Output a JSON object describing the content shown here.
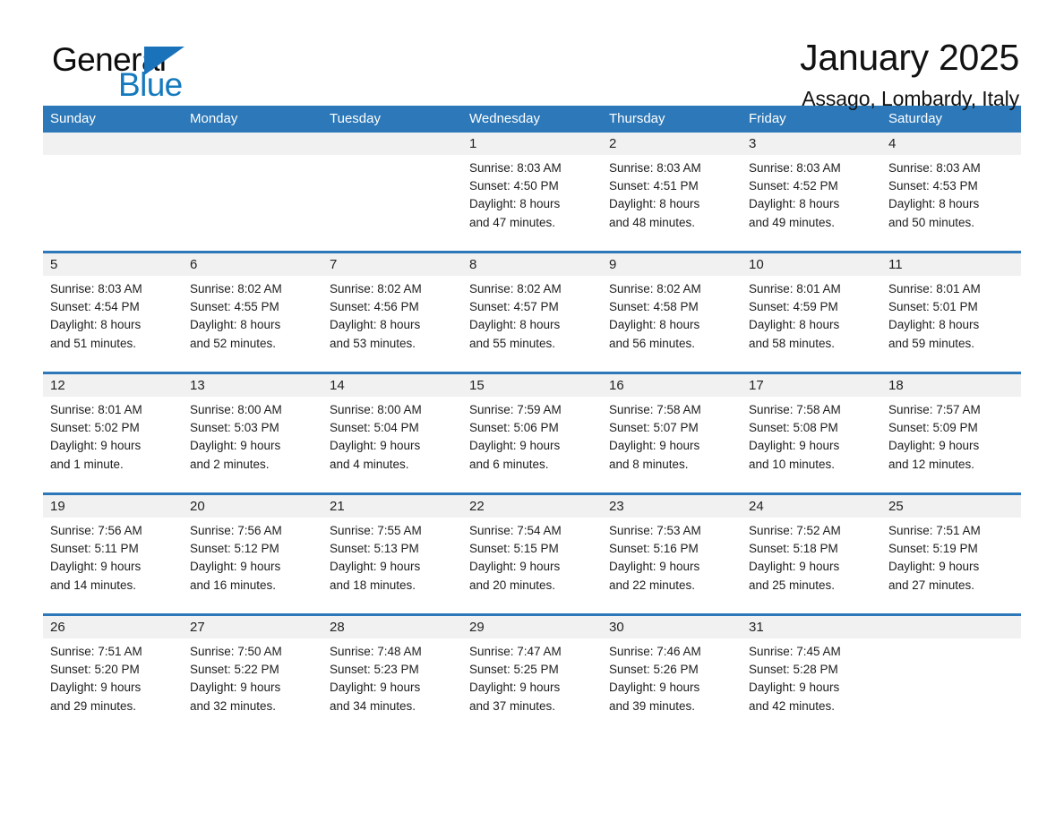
{
  "brand": {
    "word_one": "General",
    "word_two": "Blue",
    "triangle_color": "#1a72ba",
    "blue_text_color": "#1479bd"
  },
  "header": {
    "month_title": "January 2025",
    "location": "Assago, Lombardy, Italy"
  },
  "theme": {
    "header_blue": "#2c78b8",
    "day_band_gray": "#f1f1f1",
    "text_color": "#1d1d1d"
  },
  "calendar": {
    "weekdays": [
      "Sunday",
      "Monday",
      "Tuesday",
      "Wednesday",
      "Thursday",
      "Friday",
      "Saturday"
    ],
    "weeks": [
      [
        {
          "day": "",
          "empty": true,
          "sunrise": "",
          "sunset": "",
          "daylight_line1": "",
          "daylight_line2": ""
        },
        {
          "day": "",
          "empty": true,
          "sunrise": "",
          "sunset": "",
          "daylight_line1": "",
          "daylight_line2": ""
        },
        {
          "day": "",
          "empty": true,
          "sunrise": "",
          "sunset": "",
          "daylight_line1": "",
          "daylight_line2": ""
        },
        {
          "day": "1",
          "empty": false,
          "sunrise": "Sunrise: 8:03 AM",
          "sunset": "Sunset: 4:50 PM",
          "daylight_line1": "Daylight: 8 hours",
          "daylight_line2": "and 47 minutes."
        },
        {
          "day": "2",
          "empty": false,
          "sunrise": "Sunrise: 8:03 AM",
          "sunset": "Sunset: 4:51 PM",
          "daylight_line1": "Daylight: 8 hours",
          "daylight_line2": "and 48 minutes."
        },
        {
          "day": "3",
          "empty": false,
          "sunrise": "Sunrise: 8:03 AM",
          "sunset": "Sunset: 4:52 PM",
          "daylight_line1": "Daylight: 8 hours",
          "daylight_line2": "and 49 minutes."
        },
        {
          "day": "4",
          "empty": false,
          "sunrise": "Sunrise: 8:03 AM",
          "sunset": "Sunset: 4:53 PM",
          "daylight_line1": "Daylight: 8 hours",
          "daylight_line2": "and 50 minutes."
        }
      ],
      [
        {
          "day": "5",
          "empty": false,
          "sunrise": "Sunrise: 8:03 AM",
          "sunset": "Sunset: 4:54 PM",
          "daylight_line1": "Daylight: 8 hours",
          "daylight_line2": "and 51 minutes."
        },
        {
          "day": "6",
          "empty": false,
          "sunrise": "Sunrise: 8:02 AM",
          "sunset": "Sunset: 4:55 PM",
          "daylight_line1": "Daylight: 8 hours",
          "daylight_line2": "and 52 minutes."
        },
        {
          "day": "7",
          "empty": false,
          "sunrise": "Sunrise: 8:02 AM",
          "sunset": "Sunset: 4:56 PM",
          "daylight_line1": "Daylight: 8 hours",
          "daylight_line2": "and 53 minutes."
        },
        {
          "day": "8",
          "empty": false,
          "sunrise": "Sunrise: 8:02 AM",
          "sunset": "Sunset: 4:57 PM",
          "daylight_line1": "Daylight: 8 hours",
          "daylight_line2": "and 55 minutes."
        },
        {
          "day": "9",
          "empty": false,
          "sunrise": "Sunrise: 8:02 AM",
          "sunset": "Sunset: 4:58 PM",
          "daylight_line1": "Daylight: 8 hours",
          "daylight_line2": "and 56 minutes."
        },
        {
          "day": "10",
          "empty": false,
          "sunrise": "Sunrise: 8:01 AM",
          "sunset": "Sunset: 4:59 PM",
          "daylight_line1": "Daylight: 8 hours",
          "daylight_line2": "and 58 minutes."
        },
        {
          "day": "11",
          "empty": false,
          "sunrise": "Sunrise: 8:01 AM",
          "sunset": "Sunset: 5:01 PM",
          "daylight_line1": "Daylight: 8 hours",
          "daylight_line2": "and 59 minutes."
        }
      ],
      [
        {
          "day": "12",
          "empty": false,
          "sunrise": "Sunrise: 8:01 AM",
          "sunset": "Sunset: 5:02 PM",
          "daylight_line1": "Daylight: 9 hours",
          "daylight_line2": "and 1 minute."
        },
        {
          "day": "13",
          "empty": false,
          "sunrise": "Sunrise: 8:00 AM",
          "sunset": "Sunset: 5:03 PM",
          "daylight_line1": "Daylight: 9 hours",
          "daylight_line2": "and 2 minutes."
        },
        {
          "day": "14",
          "empty": false,
          "sunrise": "Sunrise: 8:00 AM",
          "sunset": "Sunset: 5:04 PM",
          "daylight_line1": "Daylight: 9 hours",
          "daylight_line2": "and 4 minutes."
        },
        {
          "day": "15",
          "empty": false,
          "sunrise": "Sunrise: 7:59 AM",
          "sunset": "Sunset: 5:06 PM",
          "daylight_line1": "Daylight: 9 hours",
          "daylight_line2": "and 6 minutes."
        },
        {
          "day": "16",
          "empty": false,
          "sunrise": "Sunrise: 7:58 AM",
          "sunset": "Sunset: 5:07 PM",
          "daylight_line1": "Daylight: 9 hours",
          "daylight_line2": "and 8 minutes."
        },
        {
          "day": "17",
          "empty": false,
          "sunrise": "Sunrise: 7:58 AM",
          "sunset": "Sunset: 5:08 PM",
          "daylight_line1": "Daylight: 9 hours",
          "daylight_line2": "and 10 minutes."
        },
        {
          "day": "18",
          "empty": false,
          "sunrise": "Sunrise: 7:57 AM",
          "sunset": "Sunset: 5:09 PM",
          "daylight_line1": "Daylight: 9 hours",
          "daylight_line2": "and 12 minutes."
        }
      ],
      [
        {
          "day": "19",
          "empty": false,
          "sunrise": "Sunrise: 7:56 AM",
          "sunset": "Sunset: 5:11 PM",
          "daylight_line1": "Daylight: 9 hours",
          "daylight_line2": "and 14 minutes."
        },
        {
          "day": "20",
          "empty": false,
          "sunrise": "Sunrise: 7:56 AM",
          "sunset": "Sunset: 5:12 PM",
          "daylight_line1": "Daylight: 9 hours",
          "daylight_line2": "and 16 minutes."
        },
        {
          "day": "21",
          "empty": false,
          "sunrise": "Sunrise: 7:55 AM",
          "sunset": "Sunset: 5:13 PM",
          "daylight_line1": "Daylight: 9 hours",
          "daylight_line2": "and 18 minutes."
        },
        {
          "day": "22",
          "empty": false,
          "sunrise": "Sunrise: 7:54 AM",
          "sunset": "Sunset: 5:15 PM",
          "daylight_line1": "Daylight: 9 hours",
          "daylight_line2": "and 20 minutes."
        },
        {
          "day": "23",
          "empty": false,
          "sunrise": "Sunrise: 7:53 AM",
          "sunset": "Sunset: 5:16 PM",
          "daylight_line1": "Daylight: 9 hours",
          "daylight_line2": "and 22 minutes."
        },
        {
          "day": "24",
          "empty": false,
          "sunrise": "Sunrise: 7:52 AM",
          "sunset": "Sunset: 5:18 PM",
          "daylight_line1": "Daylight: 9 hours",
          "daylight_line2": "and 25 minutes."
        },
        {
          "day": "25",
          "empty": false,
          "sunrise": "Sunrise: 7:51 AM",
          "sunset": "Sunset: 5:19 PM",
          "daylight_line1": "Daylight: 9 hours",
          "daylight_line2": "and 27 minutes."
        }
      ],
      [
        {
          "day": "26",
          "empty": false,
          "sunrise": "Sunrise: 7:51 AM",
          "sunset": "Sunset: 5:20 PM",
          "daylight_line1": "Daylight: 9 hours",
          "daylight_line2": "and 29 minutes."
        },
        {
          "day": "27",
          "empty": false,
          "sunrise": "Sunrise: 7:50 AM",
          "sunset": "Sunset: 5:22 PM",
          "daylight_line1": "Daylight: 9 hours",
          "daylight_line2": "and 32 minutes."
        },
        {
          "day": "28",
          "empty": false,
          "sunrise": "Sunrise: 7:48 AM",
          "sunset": "Sunset: 5:23 PM",
          "daylight_line1": "Daylight: 9 hours",
          "daylight_line2": "and 34 minutes."
        },
        {
          "day": "29",
          "empty": false,
          "sunrise": "Sunrise: 7:47 AM",
          "sunset": "Sunset: 5:25 PM",
          "daylight_line1": "Daylight: 9 hours",
          "daylight_line2": "and 37 minutes."
        },
        {
          "day": "30",
          "empty": false,
          "sunrise": "Sunrise: 7:46 AM",
          "sunset": "Sunset: 5:26 PM",
          "daylight_line1": "Daylight: 9 hours",
          "daylight_line2": "and 39 minutes."
        },
        {
          "day": "31",
          "empty": false,
          "sunrise": "Sunrise: 7:45 AM",
          "sunset": "Sunset: 5:28 PM",
          "daylight_line1": "Daylight: 9 hours",
          "daylight_line2": "and 42 minutes."
        },
        {
          "day": "",
          "empty": true,
          "sunrise": "",
          "sunset": "",
          "daylight_line1": "",
          "daylight_line2": ""
        }
      ]
    ]
  }
}
